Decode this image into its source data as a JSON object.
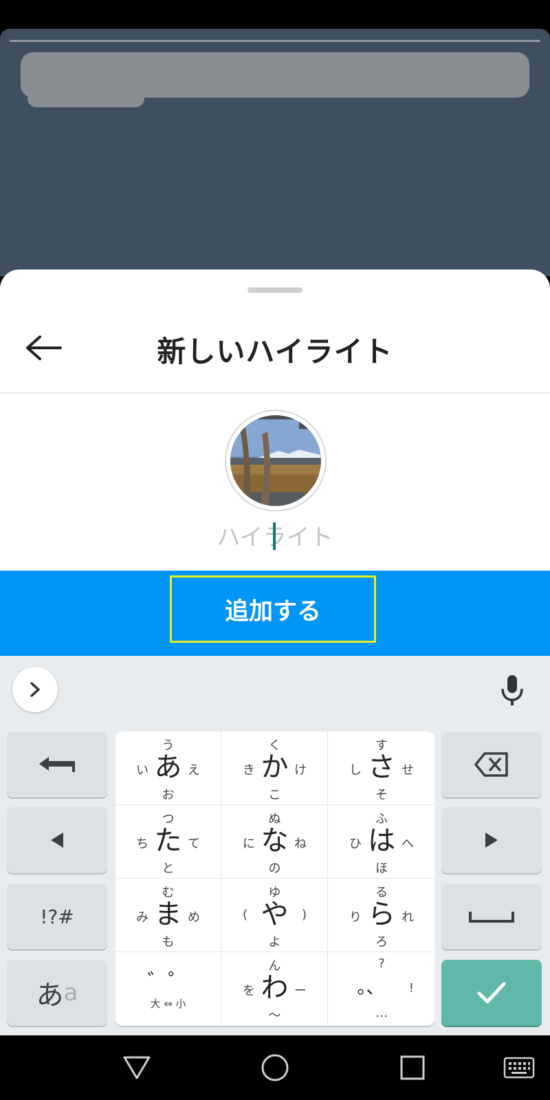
{
  "sheet": {
    "title": "新しいハイライト",
    "name_placeholder": "ハイライト",
    "add_button_label": "追加する"
  },
  "keyboard": {
    "rows": [
      [
        {
          "main": "あ",
          "top": "う",
          "bottom": "お",
          "left": "い",
          "right": "え"
        },
        {
          "main": "か",
          "top": "く",
          "bottom": "こ",
          "left": "き",
          "right": "け"
        },
        {
          "main": "さ",
          "top": "す",
          "bottom": "そ",
          "left": "し",
          "right": "せ"
        }
      ],
      [
        {
          "main": "た",
          "top": "つ",
          "bottom": "と",
          "left": "ち",
          "right": "て"
        },
        {
          "main": "な",
          "top": "ぬ",
          "bottom": "の",
          "left": "に",
          "right": "ね"
        },
        {
          "main": "は",
          "top": "ふ",
          "bottom": "ほ",
          "left": "ひ",
          "right": "へ"
        }
      ],
      [
        {
          "main": "ま",
          "top": "む",
          "bottom": "も",
          "left": "み",
          "right": "め"
        },
        {
          "main": "や",
          "top": "ゆ",
          "bottom": "よ",
          "left": "(",
          "right": ")"
        },
        {
          "main": "ら",
          "top": "る",
          "bottom": "ろ",
          "left": "り",
          "right": "れ"
        }
      ],
      [
        {
          "main": "゛゜",
          "top": "",
          "bottom": "大 ⇔ 小",
          "left": "",
          "right": ""
        },
        {
          "main": "わ",
          "top": "ん",
          "bottom": "〜",
          "left": "を",
          "right": "ー"
        },
        {
          "main": "。、",
          "top": "?",
          "bottom": "…",
          "left": "",
          "right": "!"
        }
      ]
    ],
    "symbols_label": "!?#",
    "mode_label": "あ",
    "mode_label_alt": "a"
  },
  "colors": {
    "accent_blue": "#0095f6",
    "highlight_box": "#e6f01e",
    "enter_key": "#5fb8a8",
    "backdrop": "#3f4f5f"
  },
  "icons": [
    "back-arrow-icon",
    "chevron-right-icon",
    "microphone-icon",
    "undo-icon",
    "backspace-icon",
    "arrow-left-icon",
    "arrow-right-icon",
    "space-icon",
    "checkmark-icon",
    "nav-back-icon",
    "nav-home-icon",
    "nav-recents-icon",
    "keyboard-icon"
  ]
}
